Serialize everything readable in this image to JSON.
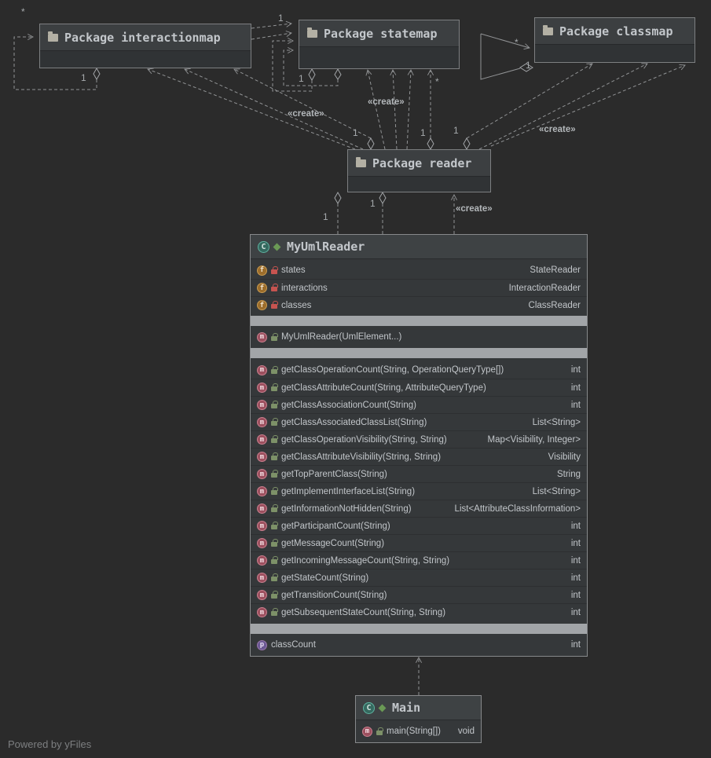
{
  "app": {
    "watermark": "Powered by yFiles"
  },
  "colors": {
    "background": "#2b2b2b",
    "node_header": "#3c3f41",
    "node_body": "#303335",
    "node_border": "#7d7f81",
    "separator_band": "#a2a5a8",
    "edge": "#919395",
    "text": "#c2c6ca",
    "class_icon": "#5fb3a1",
    "field_icon": "#c89a50",
    "method_icon": "#c97f8e",
    "property_icon": "#9876aa",
    "private_lock": "#c75450",
    "public_lock": "#7d9168"
  },
  "icons": {
    "class_glyph": "C",
    "field_glyph": "f",
    "method_glyph": "m",
    "property_glyph": "p"
  },
  "packages": [
    {
      "label": "Package interactionmap"
    },
    {
      "label": "Package statemap"
    },
    {
      "label": "Package classmap"
    },
    {
      "label": "Package reader"
    }
  ],
  "uml_reader": {
    "title": "MyUmlReader",
    "fields": [
      {
        "name": "states",
        "type": "StateReader"
      },
      {
        "name": "interactions",
        "type": "InteractionReader"
      },
      {
        "name": "classes",
        "type": "ClassReader"
      }
    ],
    "constructor": {
      "name": "MyUmlReader(UmlElement...)",
      "type": ""
    },
    "methods": [
      {
        "name": "getClassOperationCount(String, OperationQueryType[])",
        "type": "int"
      },
      {
        "name": "getClassAttributeCount(String, AttributeQueryType)",
        "type": "int"
      },
      {
        "name": "getClassAssociationCount(String)",
        "type": "int"
      },
      {
        "name": "getClassAssociatedClassList(String)",
        "type": "List<String>"
      },
      {
        "name": "getClassOperationVisibility(String, String)",
        "type": "Map<Visibility, Integer>"
      },
      {
        "name": "getClassAttributeVisibility(String, String)",
        "type": "Visibility"
      },
      {
        "name": "getTopParentClass(String)",
        "type": "String"
      },
      {
        "name": "getImplementInterfaceList(String)",
        "type": "List<String>"
      },
      {
        "name": "getInformationNotHidden(String)",
        "type": "List<AttributeClassInformation>"
      },
      {
        "name": "getParticipantCount(String)",
        "type": "int"
      },
      {
        "name": "getMessageCount(String)",
        "type": "int"
      },
      {
        "name": "getIncomingMessageCount(String, String)",
        "type": "int"
      },
      {
        "name": "getStateCount(String)",
        "type": "int"
      },
      {
        "name": "getTransitionCount(String)",
        "type": "int"
      },
      {
        "name": "getSubsequentStateCount(String, String)",
        "type": "int"
      }
    ],
    "property": {
      "name": "classCount",
      "type": "int"
    }
  },
  "main_class": {
    "title": "Main",
    "method": {
      "name": "main(String[])",
      "type": "void"
    }
  },
  "edge_labels": [
    {
      "text": "*"
    },
    {
      "text": "1"
    },
    {
      "text": "1"
    },
    {
      "text": "1"
    },
    {
      "text": "«create»"
    },
    {
      "text": "«create»"
    },
    {
      "text": "*"
    },
    {
      "text": "*"
    },
    {
      "text": "1"
    },
    {
      "text": "«create»"
    },
    {
      "text": "1"
    },
    {
      "text": "1"
    },
    {
      "text": "1"
    },
    {
      "text": "1"
    },
    {
      "text": "1"
    },
    {
      "text": "«create»"
    }
  ]
}
